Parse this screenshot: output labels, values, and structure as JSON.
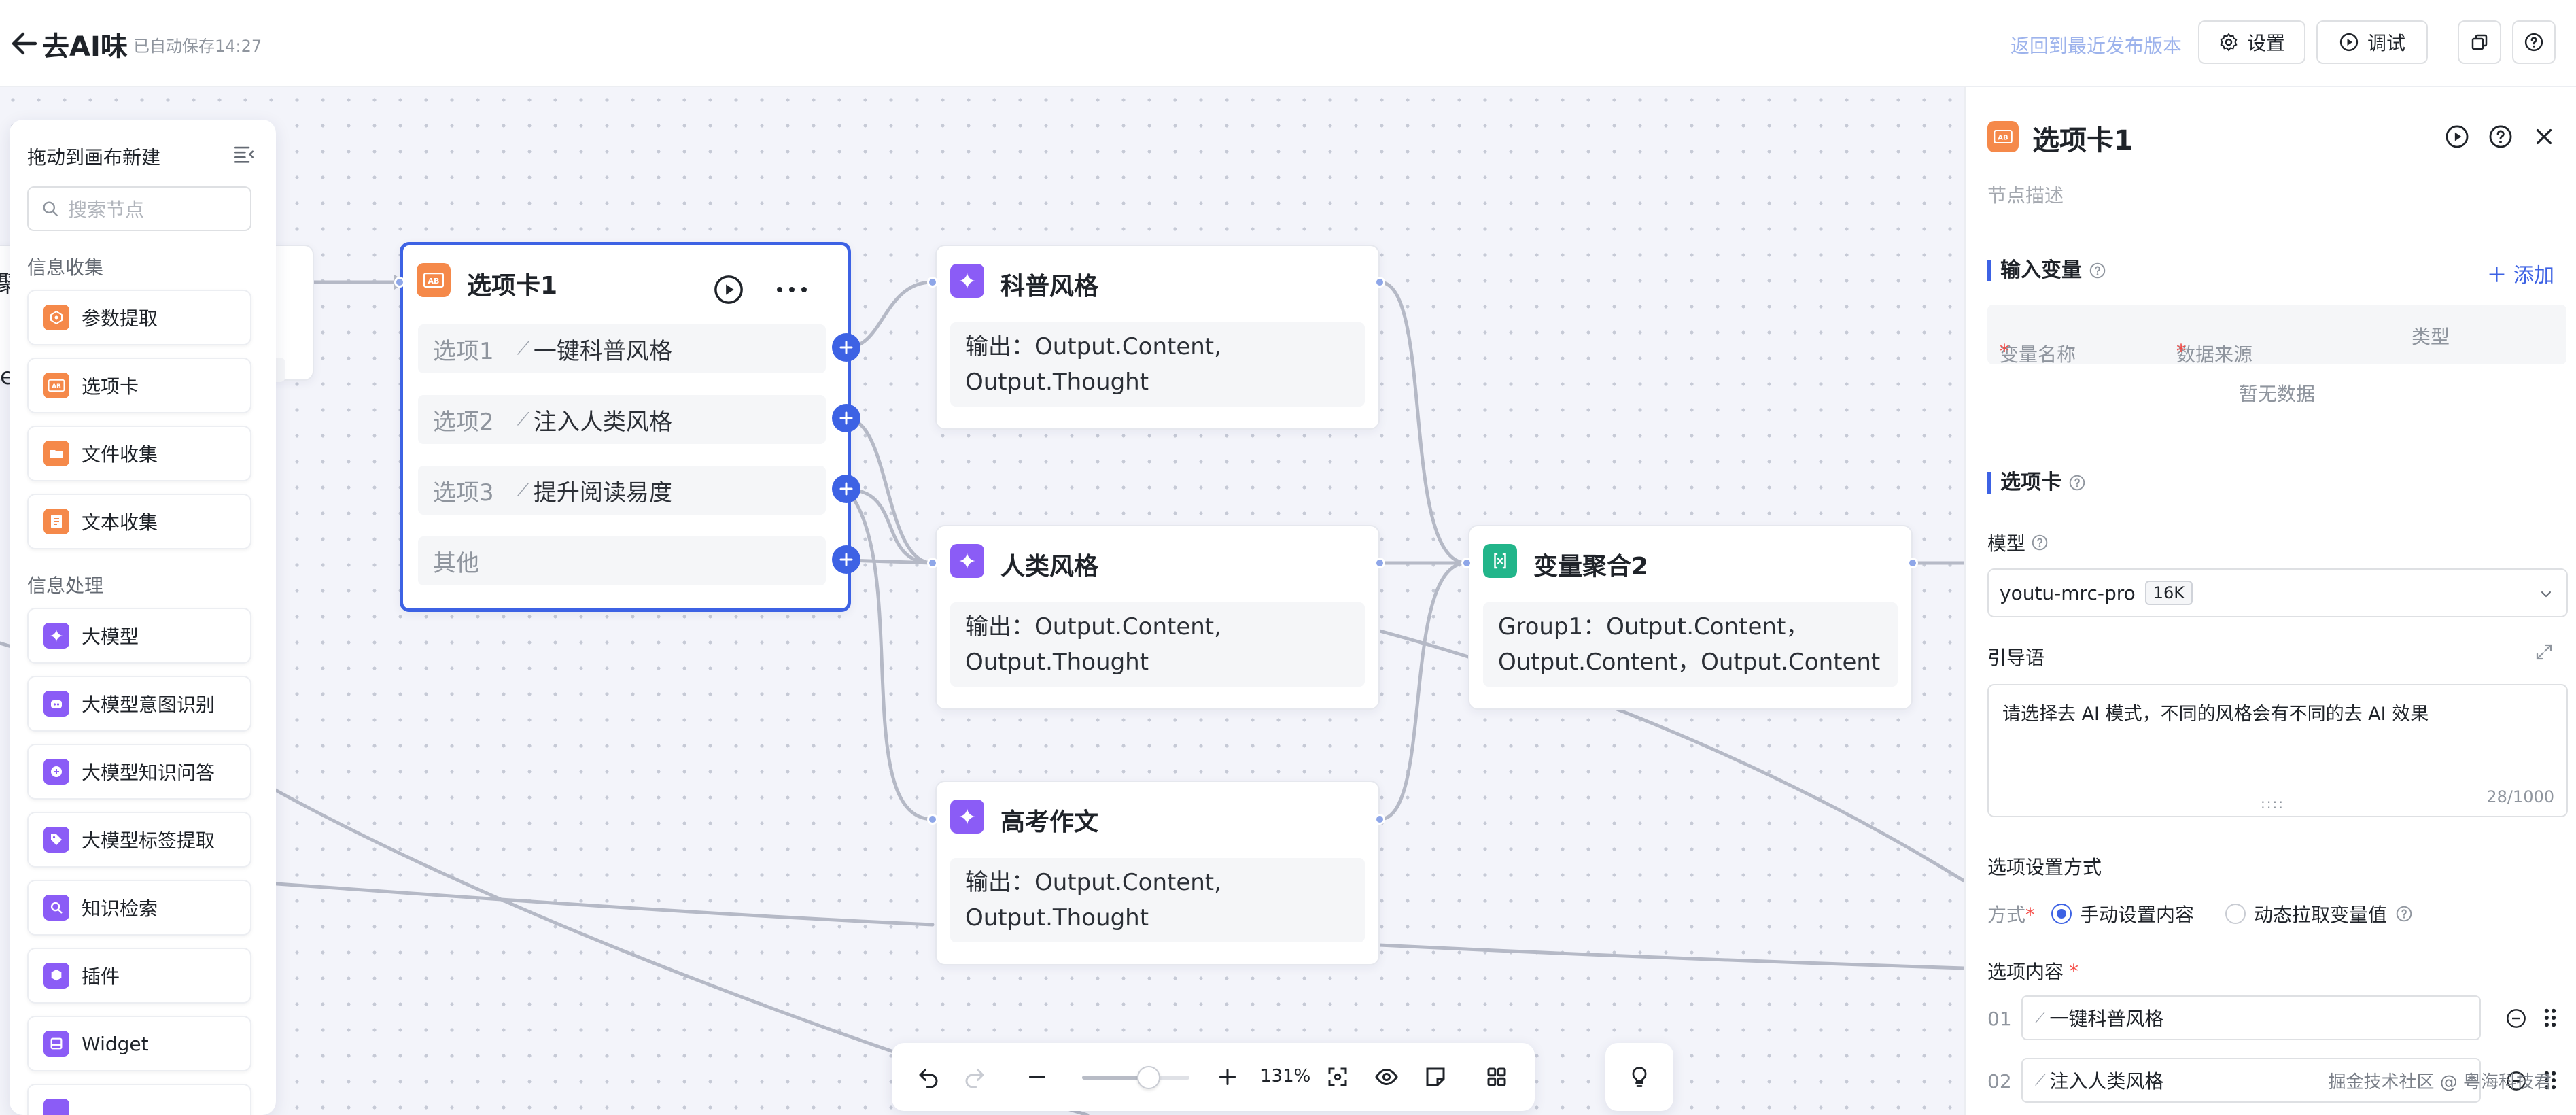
{
  "header": {
    "title": "去AI味",
    "save_status": "已自动保存14:27",
    "restore_link": "返回到最近发布版本",
    "settings_label": "设置",
    "debug_label": "调试"
  },
  "palette": {
    "title": "拖动到画布新建",
    "search_placeholder": "搜索节点",
    "sections": [
      {
        "label": "信息收集",
        "items": [
          "参数提取",
          "选项卡",
          "文件收集",
          "文本收集"
        ]
      },
      {
        "label": "信息处理",
        "items": [
          "大模型",
          "大模型意图识别",
          "大模型知识问答",
          "大模型标签提取",
          "知识检索",
          "插件",
          "Widget"
        ]
      }
    ]
  },
  "canvas": {
    "edge_partial_text": "e",
    "edge_partial_text2": "聚",
    "option_node": {
      "title": "选项卡1",
      "options": [
        {
          "key": "选项1",
          "value": "一键科普风格"
        },
        {
          "key": "选项2",
          "value": "注入人类风格"
        },
        {
          "key": "选项3",
          "value": "提升阅读易度"
        },
        {
          "key": "其他",
          "value": ""
        }
      ]
    },
    "llm_nodes": [
      {
        "title": "科普风格",
        "output": "输出：Output.Content, Output.Thought"
      },
      {
        "title": "人类风格",
        "output": "输出：Output.Content, Output.Thought"
      },
      {
        "title": "高考作文",
        "output": "输出：Output.Content, Output.Thought"
      }
    ],
    "agg_node": {
      "title": "变量聚合2",
      "output": "Group1：Output.Content，Output.Content，Output.Content"
    }
  },
  "zoom": {
    "level": "131%",
    "slider_fraction": 0.62
  },
  "panel": {
    "title": "选项卡1",
    "description_placeholder": "节点描述",
    "input_vars": {
      "title": "输入变量",
      "add_label": "添加",
      "col_name": "变量名称",
      "col_source": "数据来源",
      "col_type": "类型",
      "required_mark": "*",
      "empty_text": "暂无数据"
    },
    "option_section": {
      "title": "选项卡",
      "model_label": "模型",
      "model_value": "youtu-mrc-pro",
      "model_tag": "16K",
      "prompt_label": "引导语",
      "prompt_value": "请选择去 AI 模式，不同的风格会有不同的去 AI 效果",
      "prompt_count": "28/1000",
      "prompt_grip": "::::",
      "setting_label": "选项设置方式",
      "mode_label": "方式",
      "mode_manual": "手动设置内容",
      "mode_dynamic": "动态拉取变量值",
      "content_label": "选项内容",
      "options": [
        {
          "index": "01",
          "value": "一键科普风格"
        },
        {
          "index": "02",
          "value": "注入人类风格"
        }
      ]
    },
    "watermark": "掘金技术社区 @ 粤海科技君"
  },
  "colors": {
    "accent": "#3d62e4",
    "option_node_icon": "#f5894a",
    "llm_icon": "#8b5cf6",
    "aggregate_icon": "#22b58a"
  }
}
